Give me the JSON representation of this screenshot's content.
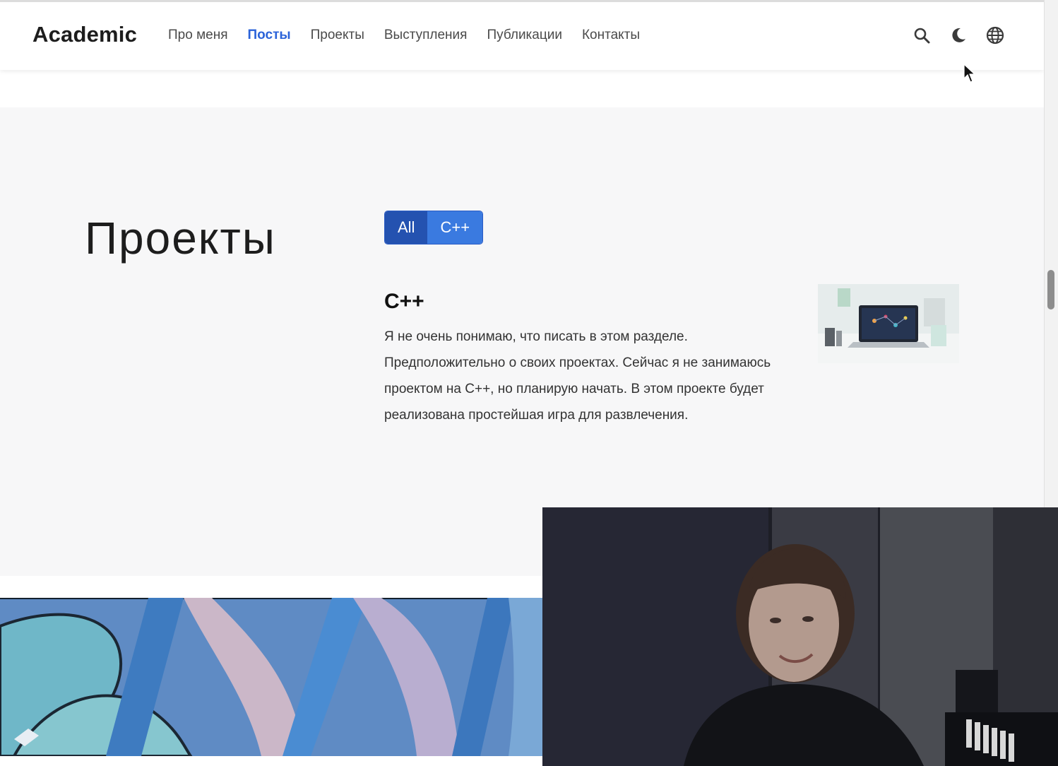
{
  "navbar": {
    "brand": "Academic",
    "links": [
      {
        "label": "Про меня"
      },
      {
        "label": "Посты"
      },
      {
        "label": "Проекты"
      },
      {
        "label": "Выступления"
      },
      {
        "label": "Публикации"
      },
      {
        "label": "Контакты"
      }
    ],
    "active_link": "Посты",
    "icons": [
      "search-icon",
      "moon-icon",
      "globe-icon"
    ]
  },
  "projects": {
    "title": "Проекты",
    "filters": [
      {
        "label": "All",
        "active": true
      },
      {
        "label": "C++",
        "active": false
      }
    ],
    "card": {
      "title": "C++",
      "summary": "Я не очень понимаю, что писать в этом разделе. Предположительно о своих проектах. Сейчас я не занимаюсь проектом на C++, но планирую начать. В этом проекте будет реализована простейшая игра для развлечения.",
      "thumbnail": "laptop-photo"
    }
  },
  "colors": {
    "accent": "#2b63d9",
    "filter_active": "#2452b0",
    "filter_inactive": "#3a7ae0",
    "section_bg": "#f7f7f8"
  }
}
